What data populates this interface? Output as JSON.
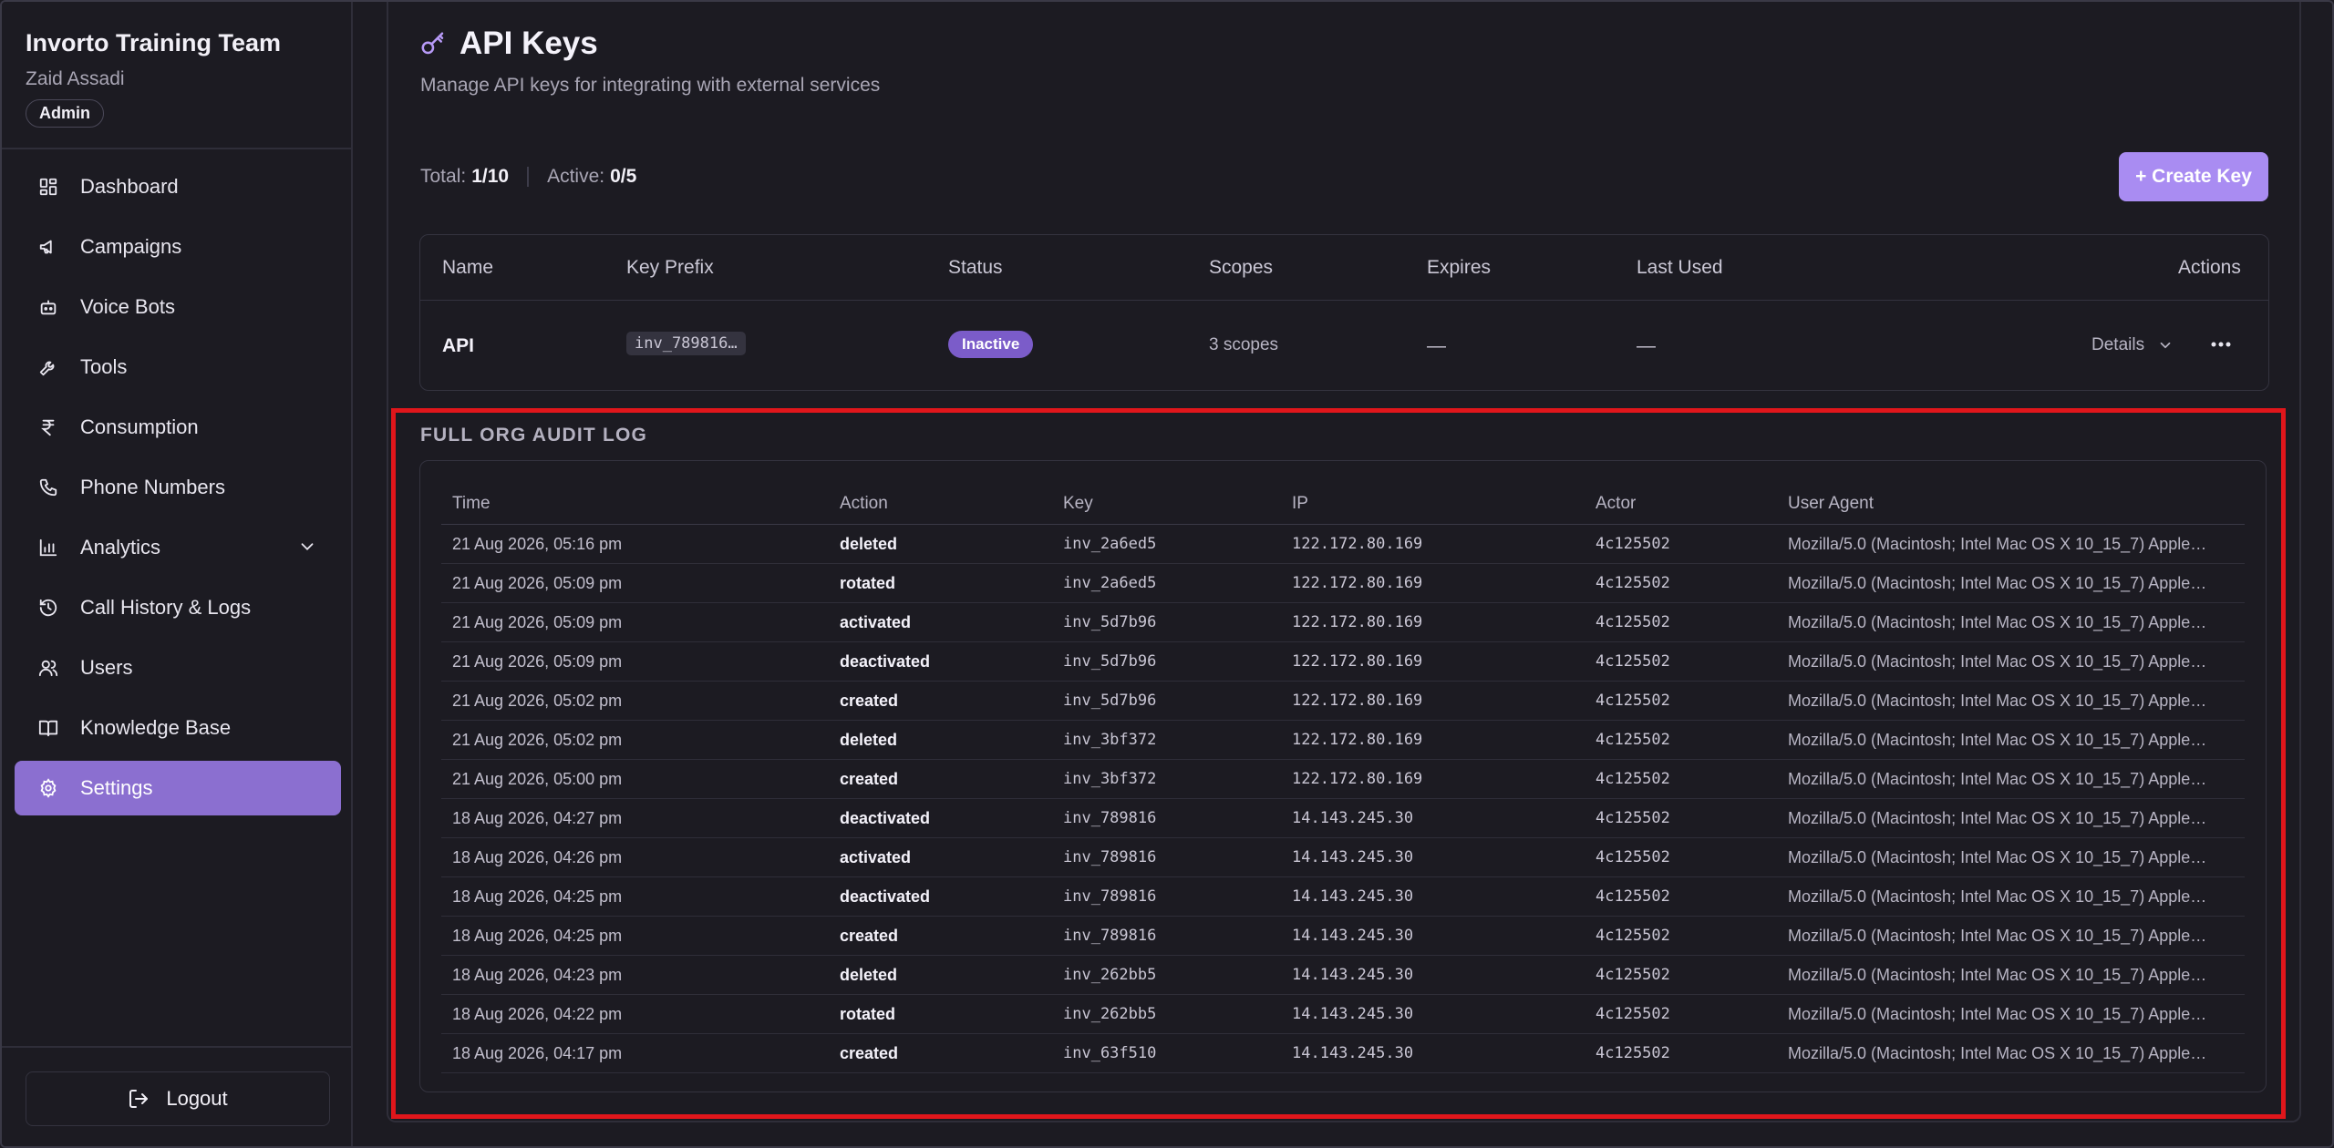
{
  "sidebar": {
    "org_name": "Invorto Training Team",
    "user_name": "Zaid Assadi",
    "role": "Admin",
    "items": [
      {
        "label": "Dashboard",
        "icon": "dashboard-grid-icon"
      },
      {
        "label": "Campaigns",
        "icon": "megaphone-icon"
      },
      {
        "label": "Voice Bots",
        "icon": "bot-icon"
      },
      {
        "label": "Tools",
        "icon": "wrench-icon"
      },
      {
        "label": "Consumption",
        "icon": "rupee-icon"
      },
      {
        "label": "Phone Numbers",
        "icon": "phone-icon"
      },
      {
        "label": "Analytics",
        "icon": "bar-chart-icon"
      },
      {
        "label": "Call History & Logs",
        "icon": "history-icon"
      },
      {
        "label": "Users",
        "icon": "users-icon"
      },
      {
        "label": "Knowledge Base",
        "icon": "book-icon"
      },
      {
        "label": "Settings",
        "icon": "gear-icon"
      }
    ],
    "active_item": "Settings",
    "logout_label": "Logout"
  },
  "page": {
    "title": "API Keys",
    "subtitle": "Manage API keys for integrating with external services",
    "stats": {
      "total_label": "Total:",
      "total_value": "1/10",
      "active_label": "Active:",
      "active_value": "0/5"
    },
    "create_button": "+ Create Key"
  },
  "keys_table": {
    "columns": [
      "Name",
      "Key Prefix",
      "Status",
      "Scopes",
      "Expires",
      "Last Used",
      "Actions"
    ],
    "rows": [
      {
        "name": "API",
        "prefix": "inv_789816…",
        "status": "Inactive",
        "scopes": "3 scopes",
        "expires": "—",
        "last_used": "—",
        "details_label": "Details"
      }
    ]
  },
  "audit_log": {
    "title": "FULL ORG AUDIT LOG",
    "columns": [
      "Time",
      "Action",
      "Key",
      "IP",
      "Actor",
      "User Agent"
    ],
    "rows": [
      {
        "time": "21 Aug 2026, 05:16 pm",
        "action": "deleted",
        "key": "inv_2a6ed5",
        "ip": "122.172.80.169",
        "actor": "4c125502",
        "ua": "Mozilla/5.0 (Macintosh; Intel Mac OS X 10_15_7) Apple…"
      },
      {
        "time": "21 Aug 2026, 05:09 pm",
        "action": "rotated",
        "key": "inv_2a6ed5",
        "ip": "122.172.80.169",
        "actor": "4c125502",
        "ua": "Mozilla/5.0 (Macintosh; Intel Mac OS X 10_15_7) Apple…"
      },
      {
        "time": "21 Aug 2026, 05:09 pm",
        "action": "activated",
        "key": "inv_5d7b96",
        "ip": "122.172.80.169",
        "actor": "4c125502",
        "ua": "Mozilla/5.0 (Macintosh; Intel Mac OS X 10_15_7) Apple…"
      },
      {
        "time": "21 Aug 2026, 05:09 pm",
        "action": "deactivated",
        "key": "inv_5d7b96",
        "ip": "122.172.80.169",
        "actor": "4c125502",
        "ua": "Mozilla/5.0 (Macintosh; Intel Mac OS X 10_15_7) Apple…"
      },
      {
        "time": "21 Aug 2026, 05:02 pm",
        "action": "created",
        "key": "inv_5d7b96",
        "ip": "122.172.80.169",
        "actor": "4c125502",
        "ua": "Mozilla/5.0 (Macintosh; Intel Mac OS X 10_15_7) Apple…"
      },
      {
        "time": "21 Aug 2026, 05:02 pm",
        "action": "deleted",
        "key": "inv_3bf372",
        "ip": "122.172.80.169",
        "actor": "4c125502",
        "ua": "Mozilla/5.0 (Macintosh; Intel Mac OS X 10_15_7) Apple…"
      },
      {
        "time": "21 Aug 2026, 05:00 pm",
        "action": "created",
        "key": "inv_3bf372",
        "ip": "122.172.80.169",
        "actor": "4c125502",
        "ua": "Mozilla/5.0 (Macintosh; Intel Mac OS X 10_15_7) Apple…"
      },
      {
        "time": "18 Aug 2026, 04:27 pm",
        "action": "deactivated",
        "key": "inv_789816",
        "ip": "14.143.245.30",
        "actor": "4c125502",
        "ua": "Mozilla/5.0 (Macintosh; Intel Mac OS X 10_15_7) Apple…"
      },
      {
        "time": "18 Aug 2026, 04:26 pm",
        "action": "activated",
        "key": "inv_789816",
        "ip": "14.143.245.30",
        "actor": "4c125502",
        "ua": "Mozilla/5.0 (Macintosh; Intel Mac OS X 10_15_7) Apple…"
      },
      {
        "time": "18 Aug 2026, 04:25 pm",
        "action": "deactivated",
        "key": "inv_789816",
        "ip": "14.143.245.30",
        "actor": "4c125502",
        "ua": "Mozilla/5.0 (Macintosh; Intel Mac OS X 10_15_7) Apple…"
      },
      {
        "time": "18 Aug 2026, 04:25 pm",
        "action": "created",
        "key": "inv_789816",
        "ip": "14.143.245.30",
        "actor": "4c125502",
        "ua": "Mozilla/5.0 (Macintosh; Intel Mac OS X 10_15_7) Apple…"
      },
      {
        "time": "18 Aug 2026, 04:23 pm",
        "action": "deleted",
        "key": "inv_262bb5",
        "ip": "14.143.245.30",
        "actor": "4c125502",
        "ua": "Mozilla/5.0 (Macintosh; Intel Mac OS X 10_15_7) Apple…"
      },
      {
        "time": "18 Aug 2026, 04:22 pm",
        "action": "rotated",
        "key": "inv_262bb5",
        "ip": "14.143.245.30",
        "actor": "4c125502",
        "ua": "Mozilla/5.0 (Macintosh; Intel Mac OS X 10_15_7) Apple…"
      },
      {
        "time": "18 Aug 2026, 04:17 pm",
        "action": "created",
        "key": "inv_63f510",
        "ip": "14.143.245.30",
        "actor": "4c125502",
        "ua": "Mozilla/5.0 (Macintosh; Intel Mac OS X 10_15_7) Apple…"
      }
    ]
  },
  "colors": {
    "background": "#1c1b22",
    "accent": "#8b6fd0",
    "create_button": "#a98cf2",
    "status_inactive": "#7b5cc9",
    "highlight": "#e0161b"
  }
}
